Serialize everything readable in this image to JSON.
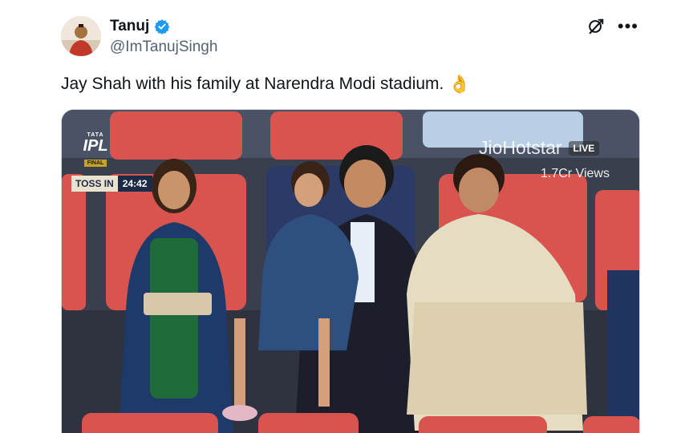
{
  "author": {
    "display_name": "Tanuj",
    "handle": "@ImTanujSingh"
  },
  "tweet": {
    "text": "Jay Shah with his family at Narendra Modi stadium.",
    "emoji": "👌"
  },
  "icons": {
    "verified": "verified-badge-icon",
    "grok": "grok-icon",
    "more": "more-options-icon"
  },
  "video_overlay": {
    "tournament_tata": "TATA",
    "tournament_logo": "IPL",
    "stage": "FINAL",
    "toss_label": "TOSS IN",
    "toss_timer": "24:42",
    "broadcaster": "JioHotstar",
    "live_label": "LIVE",
    "views": "1.7Cr Views"
  },
  "colors": {
    "verified_blue": "#1d9bf0",
    "handle_gray": "#536471",
    "seat_red": "#d9534f"
  }
}
